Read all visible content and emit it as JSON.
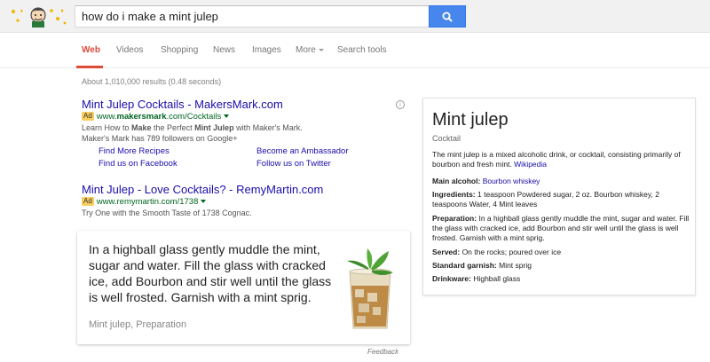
{
  "search": {
    "query": "how do i make a mint julep"
  },
  "nav": {
    "tabs": [
      {
        "label": "Web"
      },
      {
        "label": "Videos"
      },
      {
        "label": "Shopping"
      },
      {
        "label": "News"
      },
      {
        "label": "Images"
      },
      {
        "label": "More"
      },
      {
        "label": "Search tools"
      }
    ]
  },
  "stats": "About 1,010,000 results (0.48 seconds)",
  "ads": [
    {
      "title": "Mint Julep Cocktails - MakersMark.com",
      "badge": "Ad",
      "url_prefix": "www.",
      "url_bold": "makersmark",
      "url_suffix": ".com/Cocktails",
      "desc1_a": "Learn How to ",
      "desc1_b": "Make",
      "desc1_c": " the Perfect ",
      "desc1_d": "Mint Julep",
      "desc1_e": " with Maker's Mark.",
      "desc2": "Maker's Mark has 789 followers on Google+",
      "sitelinks": [
        "Find More Recipes",
        "Become an Ambassador",
        "Find us on Facebook",
        "Follow us on Twitter"
      ]
    },
    {
      "title": "Mint Julep - Love Cocktails? - RemyMartin.com",
      "badge": "Ad",
      "url": "www.remymartin.com/1738",
      "desc": "Try One with the Smooth Taste of 1738 Cognac."
    }
  ],
  "answer": {
    "text": "In a highball glass gently muddle the mint, sugar and water. Fill the glass with cracked ice, add Bourbon and stir well until the glass is well frosted. Garnish with a mint sprig.",
    "source": "Mint julep, Preparation",
    "feedback": "Feedback"
  },
  "knowledge_panel": {
    "title": "Mint julep",
    "subtitle": "Cocktail",
    "description": "The mint julep is a mixed alcoholic drink, or cocktail, consisting primarily of bourbon and fresh mint.",
    "wiki_link": "Wikipedia",
    "facts": [
      {
        "label": "Main alcohol:",
        "value": "Bourbon whiskey"
      },
      {
        "label": "Ingredients:",
        "value": "1 teaspoon Powdered sugar, 2 oz. Bourbon whiskey, 2 teaspoons Water, 4 Mint leaves"
      },
      {
        "label": "Preparation:",
        "value": "In a highball glass gently muddle the mint, sugar and water. Fill the glass with cracked ice, add Bourbon and stir well until the glass is well frosted. Garnish with a mint sprig."
      },
      {
        "label": "Served:",
        "value": "On the rocks; poured over ice"
      },
      {
        "label": "Standard garnish:",
        "value": "Mint sprig"
      },
      {
        "label": "Drinkware:",
        "value": "Highball glass"
      }
    ]
  },
  "colors": {
    "accent_red": "#dd4b39",
    "link_blue": "#1a0dab",
    "url_green": "#006621",
    "search_blue": "#4787ed",
    "ad_yellow": "#f7cd60"
  },
  "icons": {
    "logo": "google-doodle-icon",
    "search": "magnifier-icon",
    "info": "info-icon",
    "cocktail": "mint-julep-glass-image"
  }
}
